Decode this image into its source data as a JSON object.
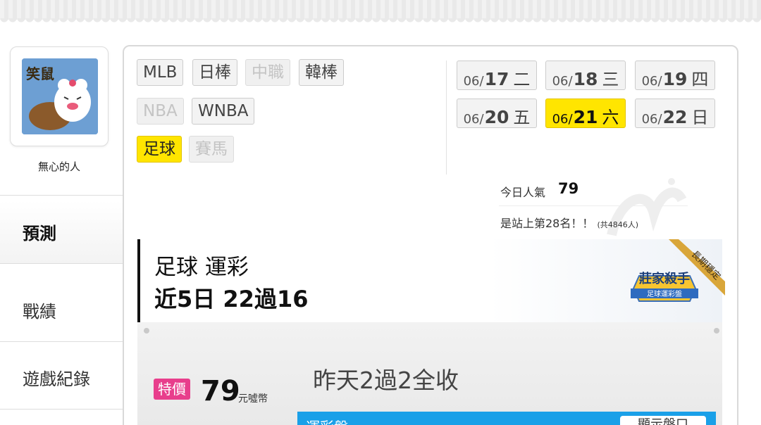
{
  "user": {
    "avatar_title": "笑鼠",
    "name": "無心的人"
  },
  "sidebar": {
    "items": [
      {
        "label": "預測",
        "active": true
      },
      {
        "label": "戰績",
        "active": false
      },
      {
        "label": "遊戲紀錄",
        "active": false
      }
    ]
  },
  "sports": {
    "tags": [
      {
        "label": "MLB",
        "state": "normal"
      },
      {
        "label": "日棒",
        "state": "normal"
      },
      {
        "label": "中職",
        "state": "disabled"
      },
      {
        "label": "韓棒",
        "state": "normal"
      },
      {
        "label": "NBA",
        "state": "disabled"
      },
      {
        "label": "WNBA",
        "state": "normal"
      },
      {
        "label": "足球",
        "state": "selected"
      },
      {
        "label": "賽馬",
        "state": "disabled"
      }
    ]
  },
  "dates": [
    {
      "month": "06/",
      "day": "17",
      "weekday": "二",
      "selected": false
    },
    {
      "month": "06/",
      "day": "18",
      "weekday": "三",
      "selected": false
    },
    {
      "month": "06/",
      "day": "19",
      "weekday": "四",
      "selected": false
    },
    {
      "month": "06/",
      "day": "20",
      "weekday": "五",
      "selected": false
    },
    {
      "month": "06/",
      "day": "21",
      "weekday": "六",
      "selected": true
    },
    {
      "month": "06/",
      "day": "22",
      "weekday": "日",
      "selected": false
    }
  ],
  "popularity": {
    "label": "今日人氣",
    "value": "79",
    "rank_text": "是站上第28名！！",
    "total_text": "(共4846人)"
  },
  "prediction": {
    "line1": "足球 運彩",
    "line2": "近5日 22過16",
    "badge_title": "莊家殺手",
    "badge_subtitle": "足球運彩盤",
    "badge_ribbon": "長期穩定",
    "price_tag": "特價",
    "price_value": "79",
    "price_unit": "元噓幣",
    "summary": "昨天2過2全收",
    "bar_label": "運彩盤",
    "bar_button": "顯示盤口"
  },
  "colors": {
    "selected": "#ffe500",
    "price_tag": "#e83e8c",
    "blue_bar": "#1aa0e8"
  }
}
